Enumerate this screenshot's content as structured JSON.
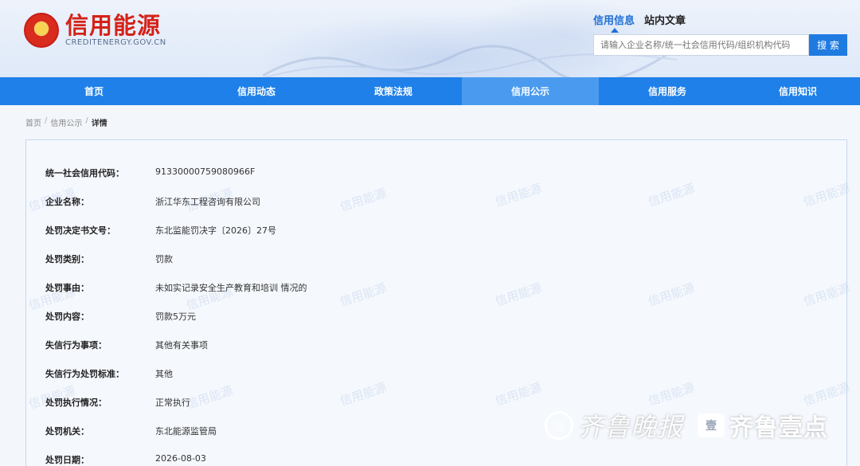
{
  "site": {
    "title": "信用能源",
    "subtitle": "CREDITENERGY.GOV.CN"
  },
  "search": {
    "tabs": [
      "信用信息",
      "站内文章"
    ],
    "placeholder": "请输入企业名称/统一社会信用代码/组织机构代码",
    "button_label": "搜 索"
  },
  "nav": {
    "items": [
      "首页",
      "信用动态",
      "政策法规",
      "信用公示",
      "信用服务",
      "信用知识"
    ],
    "active": "信用公示"
  },
  "breadcrumb": {
    "items": [
      "首页",
      "信用公示",
      "详情"
    ],
    "separator": "/"
  },
  "details": [
    {
      "label": "统一社会信用代码：",
      "value": "91330000759080966F"
    },
    {
      "label": "企业名称：",
      "value": "浙江华东工程咨询有限公司"
    },
    {
      "label": "处罚决定书文号：",
      "value": "东北监能罚决字〔2026〕27号"
    },
    {
      "label": "处罚类别：",
      "value": "罚款"
    },
    {
      "label": "处罚事由：",
      "value": "未如实记录安全生产教育和培训 情况的"
    },
    {
      "label": "处罚内容：",
      "value": "罚款5万元"
    },
    {
      "label": "失信行为事项：",
      "value": "其他有关事项"
    },
    {
      "label": "失信行为处罚标准：",
      "value": "其他"
    },
    {
      "label": "处罚执行情况：",
      "value": "正常执行"
    },
    {
      "label": "处罚机关：",
      "value": "东北能源监管局"
    },
    {
      "label": "处罚日期：",
      "value": "2026-08-03"
    }
  ],
  "watermark_text": "信用能源",
  "brand": {
    "left_text": "齐鲁晚报",
    "box_text": "壹",
    "right_text": "齐鲁壹点"
  },
  "colors": {
    "nav_bg": "#1e80e8",
    "nav_active": "#4a9bf0",
    "logo_red": "#d52218",
    "accent_blue": "#1f6fd6"
  }
}
